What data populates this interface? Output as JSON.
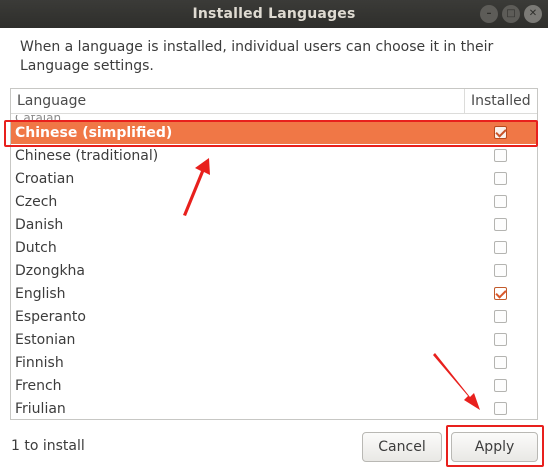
{
  "window": {
    "title": "Installed Languages",
    "controls": [
      "minimize",
      "maximize",
      "close"
    ]
  },
  "description": "When a language is installed, individual users can choose it in their Language settings.",
  "list": {
    "headers": {
      "language": "Language",
      "installed": "Installed"
    },
    "partial_row": "Catalan",
    "rows": [
      {
        "name": "Chinese (simplified)",
        "installed": true,
        "selected": true
      },
      {
        "name": "Chinese (traditional)",
        "installed": false,
        "selected": false
      },
      {
        "name": "Croatian",
        "installed": false,
        "selected": false
      },
      {
        "name": "Czech",
        "installed": false,
        "selected": false
      },
      {
        "name": "Danish",
        "installed": false,
        "selected": false
      },
      {
        "name": "Dutch",
        "installed": false,
        "selected": false
      },
      {
        "name": "Dzongkha",
        "installed": false,
        "selected": false
      },
      {
        "name": "English",
        "installed": true,
        "selected": false
      },
      {
        "name": "Esperanto",
        "installed": false,
        "selected": false
      },
      {
        "name": "Estonian",
        "installed": false,
        "selected": false
      },
      {
        "name": "Finnish",
        "installed": false,
        "selected": false
      },
      {
        "name": "French",
        "installed": false,
        "selected": false
      },
      {
        "name": "Friulian",
        "installed": false,
        "selected": false
      }
    ]
  },
  "footer": {
    "status": "1 to install",
    "cancel_label": "Cancel",
    "apply_label": "Apply"
  },
  "colors": {
    "selection": "#f07746",
    "annotation": "#e8201d",
    "titlebar": "#2e2e2b"
  }
}
